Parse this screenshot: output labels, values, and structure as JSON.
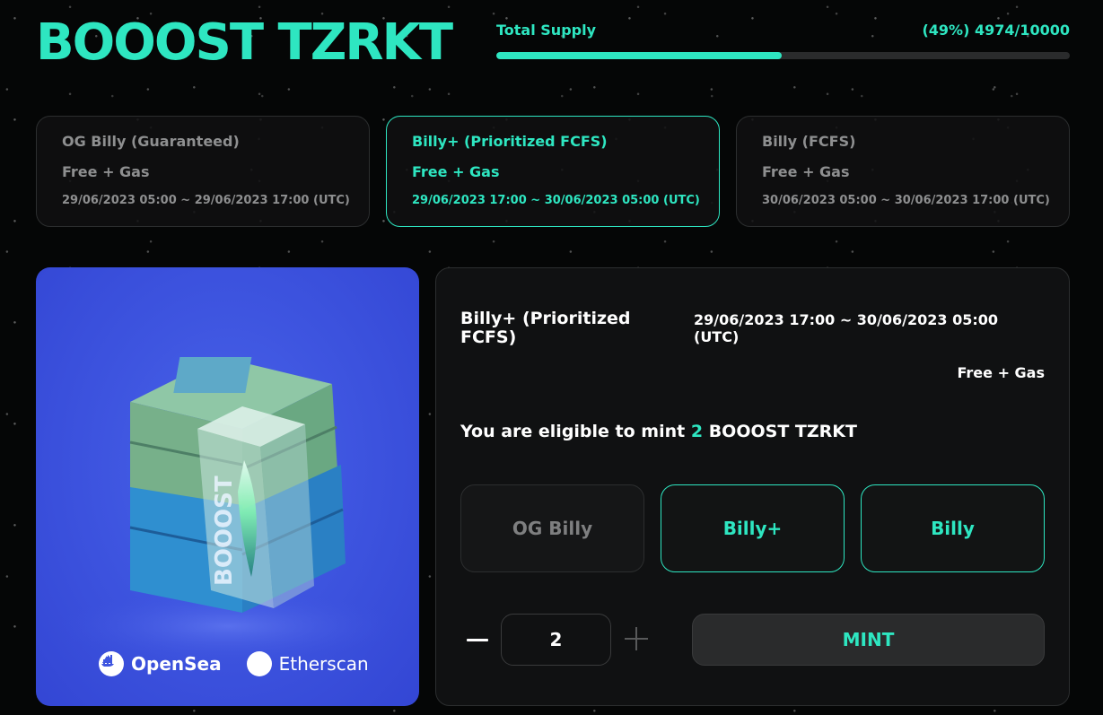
{
  "header": {
    "title": "BOOOST TZRKT"
  },
  "supply": {
    "label": "Total Supply",
    "count_text": "(49%) 4974/10000",
    "minted": 4974,
    "total": 10000,
    "percent": 49
  },
  "phases": [
    {
      "name": "OG Billy (Guaranteed)",
      "price": "Free + Gas",
      "time": "29/06/2023 05:00 ~ 29/06/2023 17:00 (UTC)",
      "active": false
    },
    {
      "name": "Billy+ (Prioritized FCFS)",
      "price": "Free + Gas",
      "time": "29/06/2023 17:00 ~ 30/06/2023 05:00 (UTC)",
      "active": true
    },
    {
      "name": "Billy (FCFS)",
      "price": "Free + Gas",
      "time": "30/06/2023 05:00 ~ 30/06/2023 17:00 (UTC)",
      "active": false
    }
  ],
  "artwork": {
    "box_lettering": "BOOOST",
    "links": {
      "opensea": "OpenSea",
      "etherscan": "Etherscan"
    }
  },
  "mint": {
    "phase_name": "Billy+ (Prioritized FCFS)",
    "phase_time": "29/06/2023 17:00 ~ 30/06/2023 05:00 (UTC)",
    "price": "Free + Gas",
    "eligible_prefix": "You are eligible to mint",
    "eligible_qty": "2",
    "eligible_suffix": "BOOOST TZRKT",
    "tiers": [
      {
        "label": "OG Billy",
        "enabled": false
      },
      {
        "label": "Billy+",
        "enabled": true
      },
      {
        "label": "Billy",
        "enabled": true
      }
    ],
    "quantity": "2",
    "button_label": "MINT"
  },
  "colors": {
    "accent": "#2ee6c1",
    "background": "#050606",
    "panel": "#101112",
    "muted_text": "#8e8f90",
    "artwork_blue": "#3e55e0"
  },
  "icons": {
    "opensea": "opensea-icon",
    "etherscan": "etherscan-icon",
    "minus": "minus-icon",
    "plus": "plus-icon"
  }
}
